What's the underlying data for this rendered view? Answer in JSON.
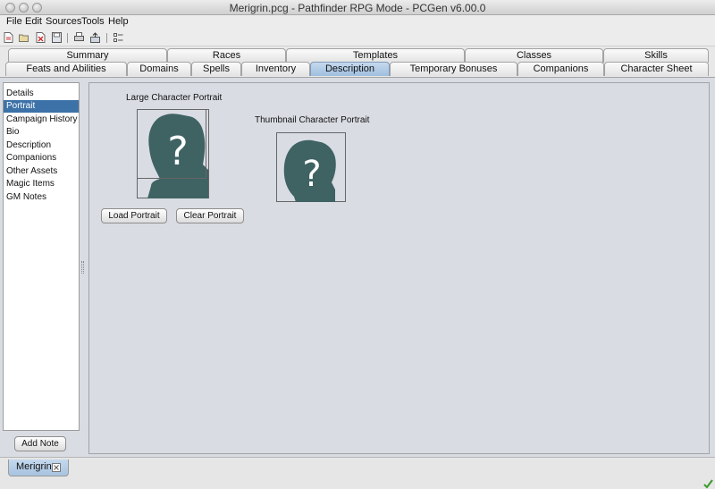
{
  "window": {
    "title": "Merigrin.pcg - Pathfinder RPG Mode - PCGen v6.00.0"
  },
  "menu": {
    "file": "File",
    "edit": "Edit",
    "sources": "Sources",
    "tools": "Tools",
    "help": "Help"
  },
  "toolbar": {
    "icons": [
      "new-character-icon",
      "open-icon",
      "close-icon",
      "save-icon",
      "print-icon",
      "export-icon",
      "preferences-icon"
    ]
  },
  "tabs": {
    "row_top": [
      "Summary",
      "Races",
      "Templates",
      "Classes",
      "Skills"
    ],
    "row_bottom": [
      "Feats and Abilities",
      "Domains",
      "Spells",
      "Inventory",
      "Description",
      "Temporary Bonuses",
      "Companions",
      "Character Sheet"
    ],
    "active": "Description"
  },
  "sidebar": {
    "items": [
      "Details",
      "Portrait",
      "Campaign History",
      "Bio",
      "Description",
      "Companions",
      "Other Assets",
      "Magic Items",
      "GM Notes"
    ],
    "selected": "Portrait",
    "add_note": "Add Note"
  },
  "portrait": {
    "large_label": "Large Character Portrait",
    "thumbnail_label": "Thumbnail Character Portrait",
    "placeholder_glyph": "?",
    "load_button": "Load Portrait",
    "clear_button": "Clear Portrait",
    "silhouette_color": "#3f6263"
  },
  "character_tabs": [
    {
      "name": "Merigrin"
    }
  ],
  "colors": {
    "selection": "#3d72a8",
    "active_tab": "#a9c6e4",
    "panel_bg": "#d9dce3"
  }
}
